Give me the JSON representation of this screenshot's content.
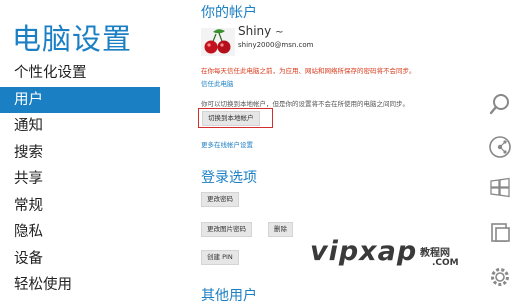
{
  "sidebar": {
    "title": "电脑设置",
    "items": [
      {
        "label": "个性化设置"
      },
      {
        "label": "用户"
      },
      {
        "label": "通知"
      },
      {
        "label": "搜索"
      },
      {
        "label": "共享"
      },
      {
        "label": "常规"
      },
      {
        "label": "隐私"
      },
      {
        "label": "设备"
      },
      {
        "label": "轻松使用"
      }
    ],
    "active_index": 1
  },
  "account": {
    "section_title": "你的帐户",
    "name": "Shiny",
    "email": "shiny2000@msn.com",
    "warning": "在你每天信任此电脑之前，为应用、网站和网络所保存的密码将不会同步。",
    "trust_link": "信任此电脑",
    "info": "你可以切换到本地帐户，但是你的设置将不会在所使用的电脑之间同步。",
    "switch_button": "切换到本地帐户",
    "more_link": "更多在线帐户设置"
  },
  "signin": {
    "section_title": "登录选项",
    "change_password": "更改密码",
    "change_picture_password": "更改图片密码",
    "remove": "删除",
    "create_pin": "创建 PIN"
  },
  "other_users": {
    "section_title": "其他用户"
  },
  "charms": [
    "search-icon",
    "share-icon",
    "start-icon",
    "devices-icon",
    "settings-icon"
  ],
  "watermark": {
    "text": "vipxap",
    "sub": "教程网",
    "sub2": ".COM"
  },
  "colors": {
    "accent": "#1b7fc4",
    "warning": "#d83b1c",
    "highlight": "#d32f2f"
  }
}
